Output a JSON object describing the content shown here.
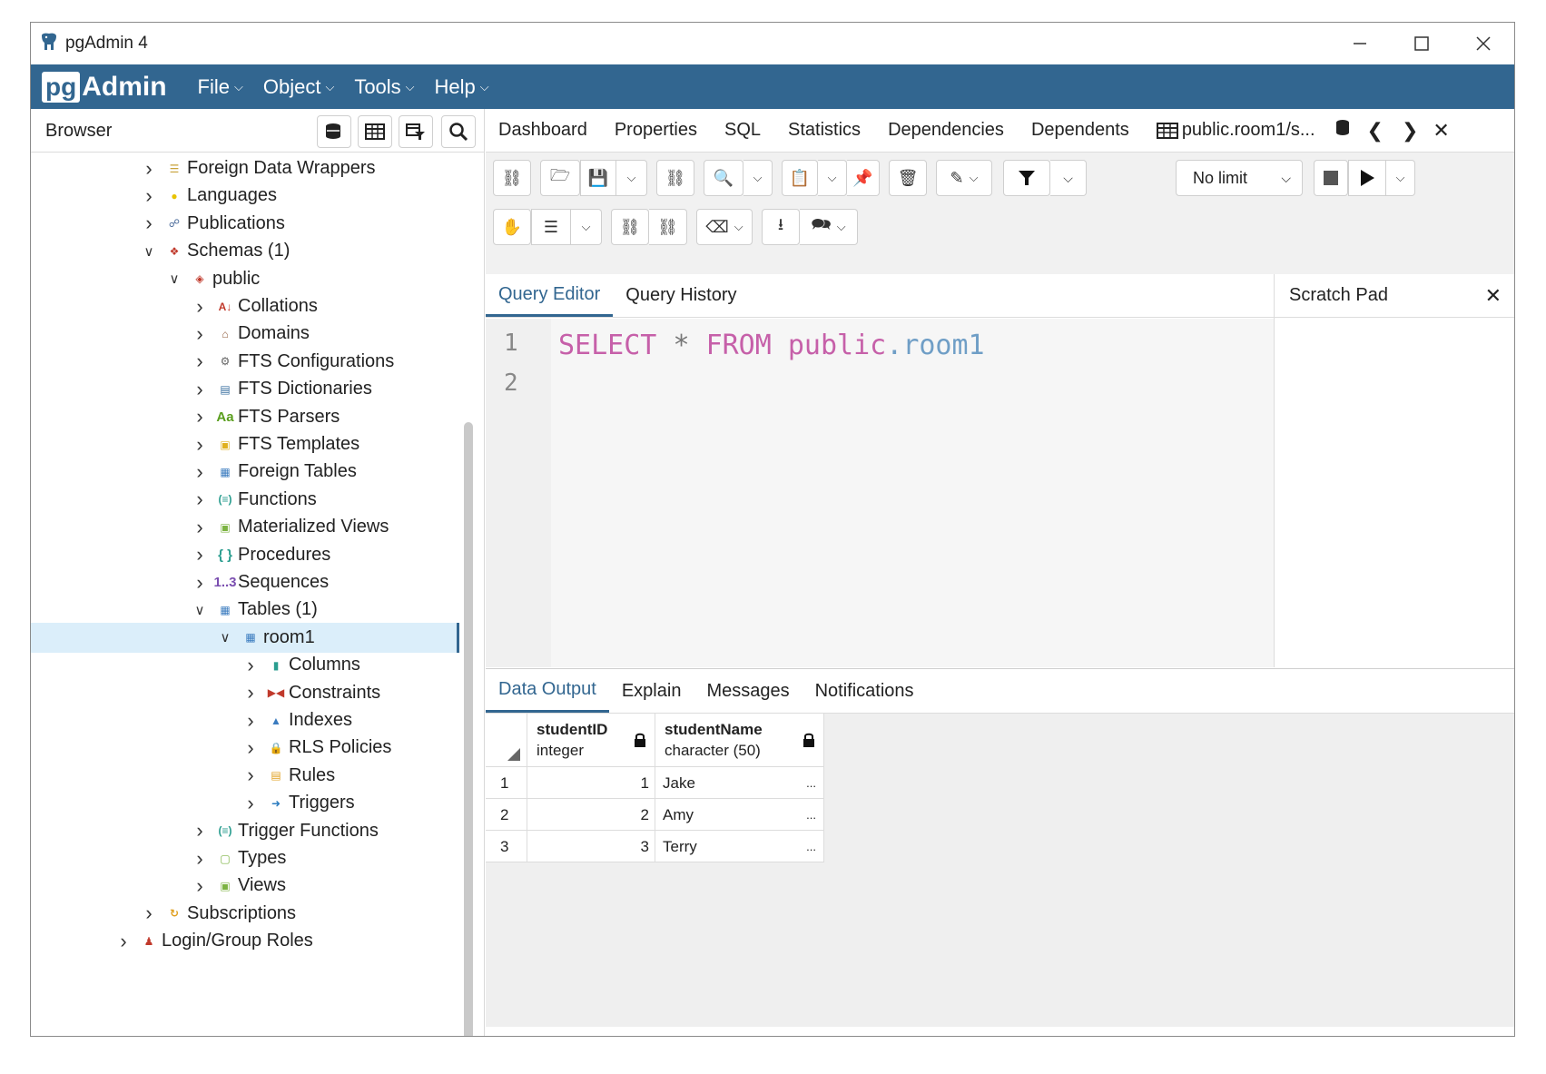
{
  "window": {
    "title": "pgAdmin 4"
  },
  "menubar": {
    "logo_pg": "pg",
    "logo_admin": "Admin",
    "items": [
      {
        "label": "File"
      },
      {
        "label": "Object"
      },
      {
        "label": "Tools"
      },
      {
        "label": "Help"
      }
    ]
  },
  "browser": {
    "title": "Browser",
    "tree": [
      {
        "label": "Foreign Data Wrappers",
        "level": 2,
        "expanded": false,
        "icon": "foreign-data-wrapper-icon"
      },
      {
        "label": "Languages",
        "level": 2,
        "expanded": false,
        "icon": "language-icon"
      },
      {
        "label": "Publications",
        "level": 2,
        "expanded": false,
        "icon": "publication-icon"
      },
      {
        "label": "Schemas (1)",
        "level": 2,
        "expanded": true,
        "icon": "schemas-icon"
      },
      {
        "label": "public",
        "level": 3,
        "expanded": true,
        "icon": "schema-icon"
      },
      {
        "label": "Collations",
        "level": 4,
        "expanded": false,
        "icon": "collation-icon"
      },
      {
        "label": "Domains",
        "level": 4,
        "expanded": false,
        "icon": "domain-icon"
      },
      {
        "label": "FTS Configurations",
        "level": 4,
        "expanded": false,
        "icon": "fts-configuration-icon"
      },
      {
        "label": "FTS Dictionaries",
        "level": 4,
        "expanded": false,
        "icon": "fts-dictionary-icon"
      },
      {
        "label": "FTS Parsers",
        "level": 4,
        "expanded": false,
        "icon": "fts-parser-icon"
      },
      {
        "label": "FTS Templates",
        "level": 4,
        "expanded": false,
        "icon": "fts-template-icon"
      },
      {
        "label": "Foreign Tables",
        "level": 4,
        "expanded": false,
        "icon": "foreign-table-icon"
      },
      {
        "label": "Functions",
        "level": 4,
        "expanded": false,
        "icon": "function-icon"
      },
      {
        "label": "Materialized Views",
        "level": 4,
        "expanded": false,
        "icon": "materialized-view-icon"
      },
      {
        "label": "Procedures",
        "level": 4,
        "expanded": false,
        "icon": "procedure-icon"
      },
      {
        "label": "Sequences",
        "level": 4,
        "expanded": false,
        "icon": "sequence-icon"
      },
      {
        "label": "Tables (1)",
        "level": 4,
        "expanded": true,
        "icon": "tables-icon"
      },
      {
        "label": "room1",
        "level": 5,
        "expanded": true,
        "icon": "table-icon",
        "selected": true
      },
      {
        "label": "Columns",
        "level": 6,
        "expanded": false,
        "icon": "columns-icon"
      },
      {
        "label": "Constraints",
        "level": 6,
        "expanded": false,
        "icon": "constraints-icon"
      },
      {
        "label": "Indexes",
        "level": 6,
        "expanded": false,
        "icon": "indexes-icon"
      },
      {
        "label": "RLS Policies",
        "level": 6,
        "expanded": false,
        "icon": "rls-policy-icon"
      },
      {
        "label": "Rules",
        "level": 6,
        "expanded": false,
        "icon": "rules-icon"
      },
      {
        "label": "Triggers",
        "level": 6,
        "expanded": false,
        "icon": "triggers-icon"
      },
      {
        "label": "Trigger Functions",
        "level": 4,
        "expanded": false,
        "icon": "trigger-function-icon"
      },
      {
        "label": "Types",
        "level": 4,
        "expanded": false,
        "icon": "types-icon"
      },
      {
        "label": "Views",
        "level": 4,
        "expanded": false,
        "icon": "views-icon"
      },
      {
        "label": "Subscriptions",
        "level": 2,
        "expanded": false,
        "icon": "subscription-icon"
      },
      {
        "label": "Login/Group Roles",
        "level": 1,
        "expanded": false,
        "icon": "login-role-icon"
      }
    ]
  },
  "top_tabs": [
    {
      "label": "Dashboard"
    },
    {
      "label": "Properties"
    },
    {
      "label": "SQL"
    },
    {
      "label": "Statistics"
    },
    {
      "label": "Dependencies"
    },
    {
      "label": "Dependents"
    },
    {
      "label": "public.room1/s..."
    }
  ],
  "toolbar": {
    "limit_value": "No limit"
  },
  "editor_tabs": [
    {
      "label": "Query Editor",
      "active": true
    },
    {
      "label": "Query History",
      "active": false
    }
  ],
  "editor": {
    "line_numbers": [
      "1",
      "2"
    ],
    "kw_select": "SELECT",
    "star": "*",
    "kw_from": "FROM",
    "schema": "public",
    "dot": ".",
    "table": "room1"
  },
  "scratch_pad": {
    "title": "Scratch Pad"
  },
  "result_tabs": [
    {
      "label": "Data Output",
      "active": true
    },
    {
      "label": "Explain",
      "active": false
    },
    {
      "label": "Messages",
      "active": false
    },
    {
      "label": "Notifications",
      "active": false
    }
  ],
  "grid": {
    "columns": [
      {
        "name": "studentID",
        "type": "integer"
      },
      {
        "name": "studentName",
        "type": "character (50)"
      }
    ],
    "rows": [
      {
        "num": "1",
        "id": "1",
        "name": "Jake",
        "more": "..."
      },
      {
        "num": "2",
        "id": "2",
        "name": "Amy",
        "more": "..."
      },
      {
        "num": "3",
        "id": "3",
        "name": "Terry",
        "more": "..."
      }
    ]
  },
  "colors": {
    "brand": "#326690",
    "keyword": "#c660a9",
    "table_name": "#6f9ec6"
  }
}
